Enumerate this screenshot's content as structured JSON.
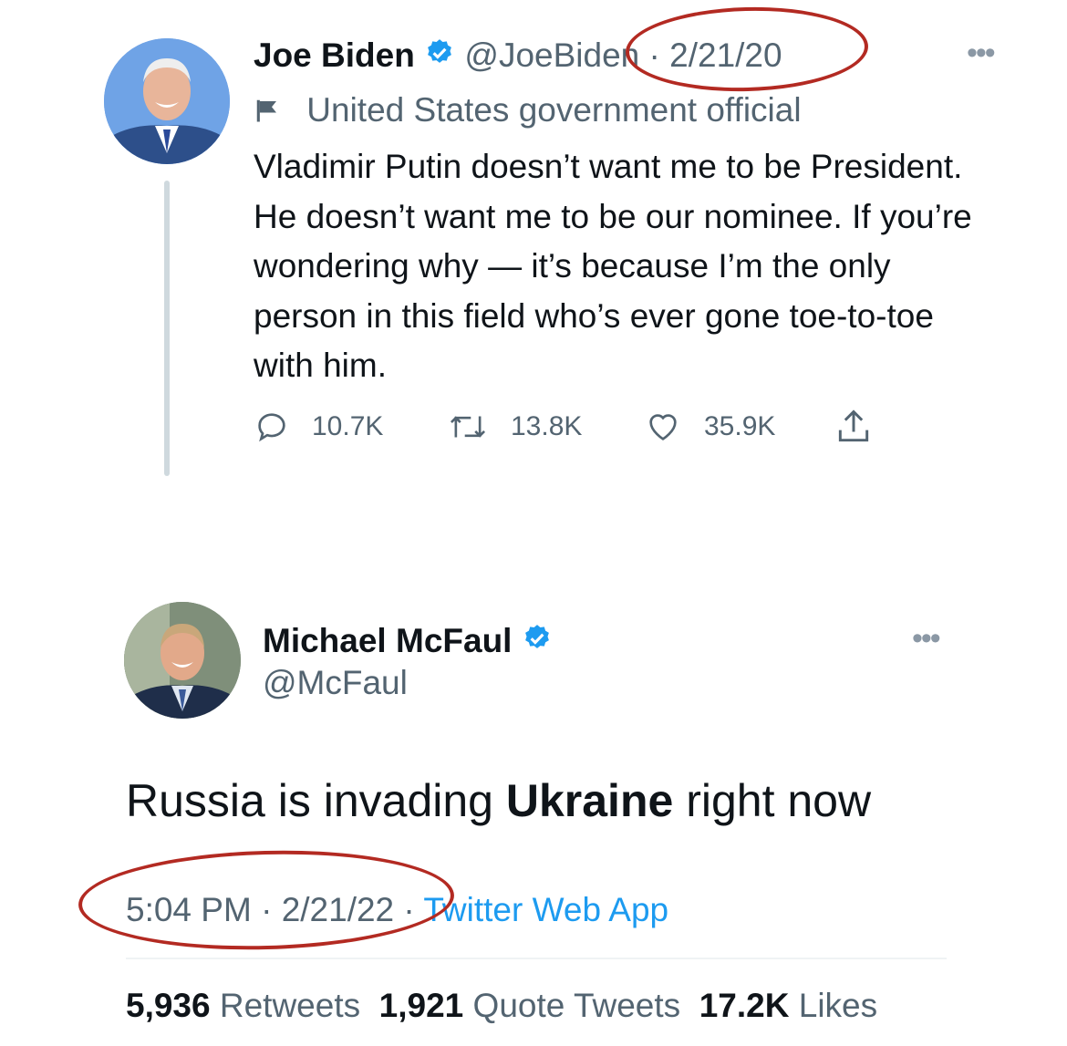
{
  "tweet1": {
    "name": "Joe Biden",
    "handle": "@JoeBiden",
    "separator": "·",
    "date": "2/21/20",
    "label": "United States government official",
    "text": "Vladimir Putin doesn’t want me to be President. He doesn’t want me to be our nominee. If you’re wondering why — it’s because I’m the only person in this field who’s ever gone toe-to-toe with him.",
    "replies": "10.7K",
    "retweets": "13.8K",
    "likes": "35.9K",
    "more": "•••"
  },
  "tweet2": {
    "name": "Michael McFaul",
    "handle": "@McFaul",
    "text_before": "Russia is invading ",
    "text_bold": "Ukraine",
    "text_after": " right now",
    "time": "5:04 PM",
    "separator": "·",
    "date": "2/21/22",
    "source": "Twitter Web App",
    "retweets_count": "5,936",
    "retweets_label": "Retweets",
    "quotes_count": "1,921",
    "quotes_label": "Quote Tweets",
    "likes_count": "17.2K",
    "likes_label": "Likes",
    "more": "•••"
  },
  "colors": {
    "verified": "#1d9bf0",
    "muted": "#536471",
    "link": "#1d9bf0",
    "annotation": "#b32a22"
  },
  "icons": [
    "verified-badge-icon",
    "flag-icon",
    "reply-icon",
    "retweet-icon",
    "like-icon",
    "share-icon",
    "more-icon"
  ]
}
